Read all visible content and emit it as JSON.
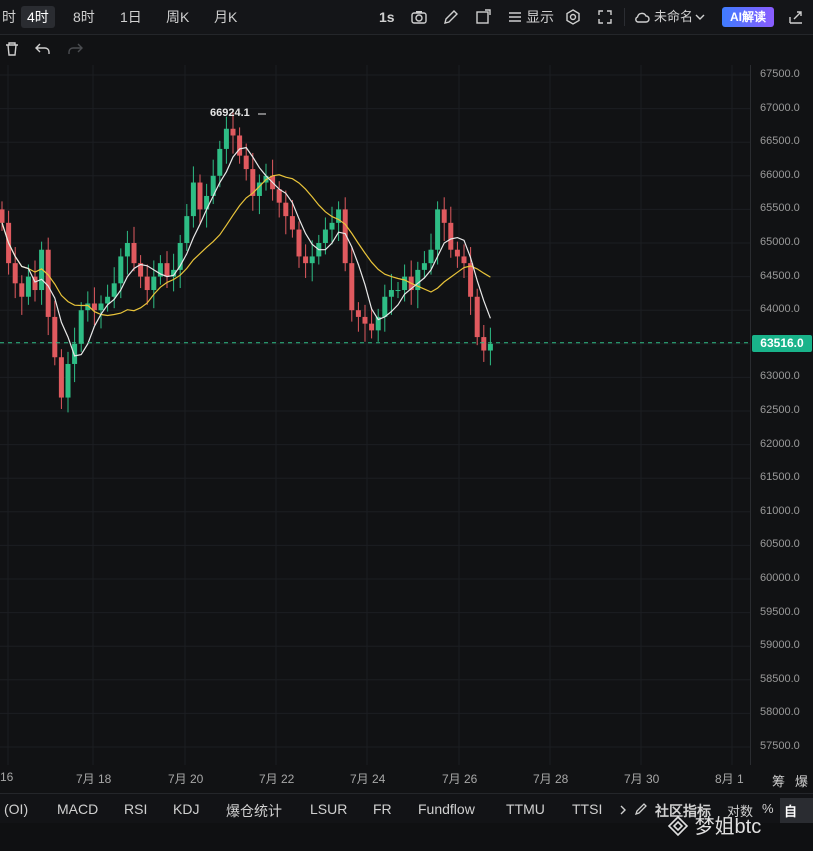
{
  "toolbar": {
    "cut_left": "时",
    "intervals": [
      "4时",
      "8时",
      "1日",
      "周K",
      "月K"
    ],
    "active_interval": "4时",
    "speed": "1s",
    "display_label": "显示",
    "cloud_label": "未命名",
    "ai_label": "AI解读"
  },
  "chart_data": {
    "type": "candlestick",
    "high_marker": "66924.1",
    "last_price": "63516.0",
    "y_ticks": [
      "67500.0",
      "67000.0",
      "66500.0",
      "66000.0",
      "65500.0",
      "65000.0",
      "64500.0",
      "64000.0",
      "63500.0",
      "63000.0",
      "62500.0",
      "62000.0",
      "61500.0",
      "61000.0",
      "60500.0",
      "60000.0",
      "59500.0",
      "59000.0",
      "58500.0",
      "58000.0",
      "57500.0"
    ],
    "x_ticks": [
      "16",
      "7月 18",
      "7月 20",
      "7月 22",
      "7月 24",
      "7月 26",
      "7月 28",
      "7月 30",
      "8月 1"
    ],
    "ylim": [
      57500,
      67500
    ],
    "colors": {
      "up": "#2ebd85",
      "down": "#e05a5f",
      "ma_fast": "#e8e8e8",
      "ma_slow": "#e9c43a",
      "last_line": "#2ebd85"
    }
  },
  "axis_right_labels": [
    "筹",
    "爆"
  ],
  "bottom_tabs": [
    "(OI)",
    "MACD",
    "RSI",
    "KDJ",
    "爆仓统计",
    "LSUR",
    "FR",
    "Fundflow",
    "TTMU",
    "TTSI"
  ],
  "bottom_right": {
    "community": "社区指标",
    "log": "对数",
    "percent": "%",
    "auto": "自动"
  },
  "watermark": "梦姐btc"
}
